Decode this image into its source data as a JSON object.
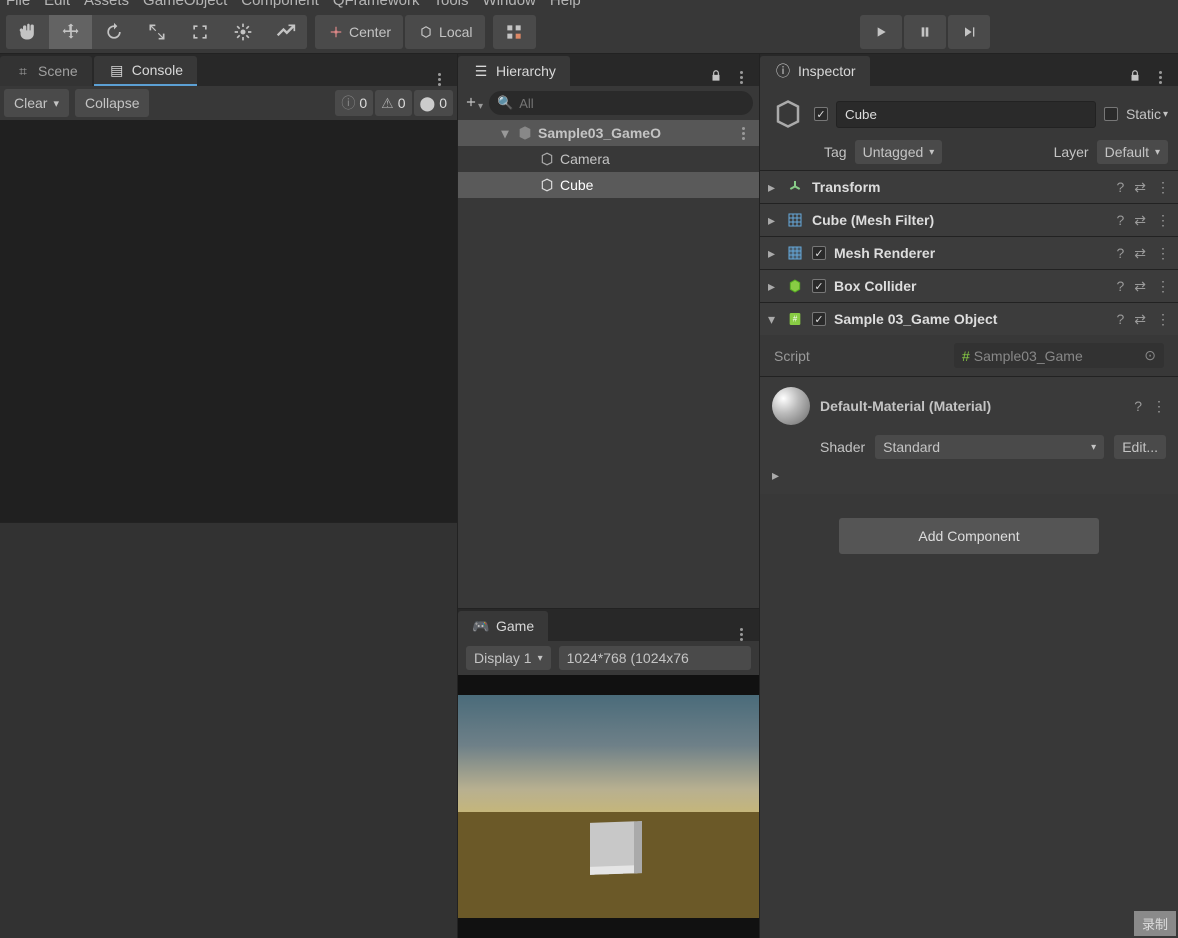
{
  "menubar": [
    "File",
    "Edit",
    "Assets",
    "GameObject",
    "Component",
    "QFramework",
    "Tools",
    "Window",
    "Help"
  ],
  "toolbar": {
    "center": "Center",
    "local": "Local"
  },
  "tabs": {
    "scene": "Scene",
    "console": "Console",
    "hierarchy": "Hierarchy",
    "game": "Game",
    "inspector": "Inspector"
  },
  "console": {
    "clear": "Clear",
    "collapse": "Collapse",
    "info": "0",
    "warn": "0",
    "error": "0"
  },
  "hierarchy": {
    "search_placeholder": "All",
    "scene": "Sample03_GameO",
    "children": [
      "Camera",
      "Cube"
    ]
  },
  "game": {
    "display": "Display 1",
    "res": "1024*768 (1024x76"
  },
  "inspector": {
    "name": "Cube",
    "static": "Static",
    "tag_label": "Tag",
    "tag": "Untagged",
    "layer_label": "Layer",
    "layer": "Default",
    "components": [
      {
        "name": "Transform",
        "checked": null
      },
      {
        "name": "Cube (Mesh Filter)",
        "checked": null
      },
      {
        "name": "Mesh Renderer",
        "checked": true
      },
      {
        "name": "Box Collider",
        "checked": true
      },
      {
        "name": "Sample 03_Game Object",
        "checked": true,
        "expanded": true
      }
    ],
    "script_label": "Script",
    "script_name": "Sample03_Game",
    "material": {
      "name": "Default-Material (Material)",
      "shader_label": "Shader",
      "shader": "Standard",
      "edit": "Edit..."
    },
    "add_component": "Add Component"
  },
  "record": "录制"
}
